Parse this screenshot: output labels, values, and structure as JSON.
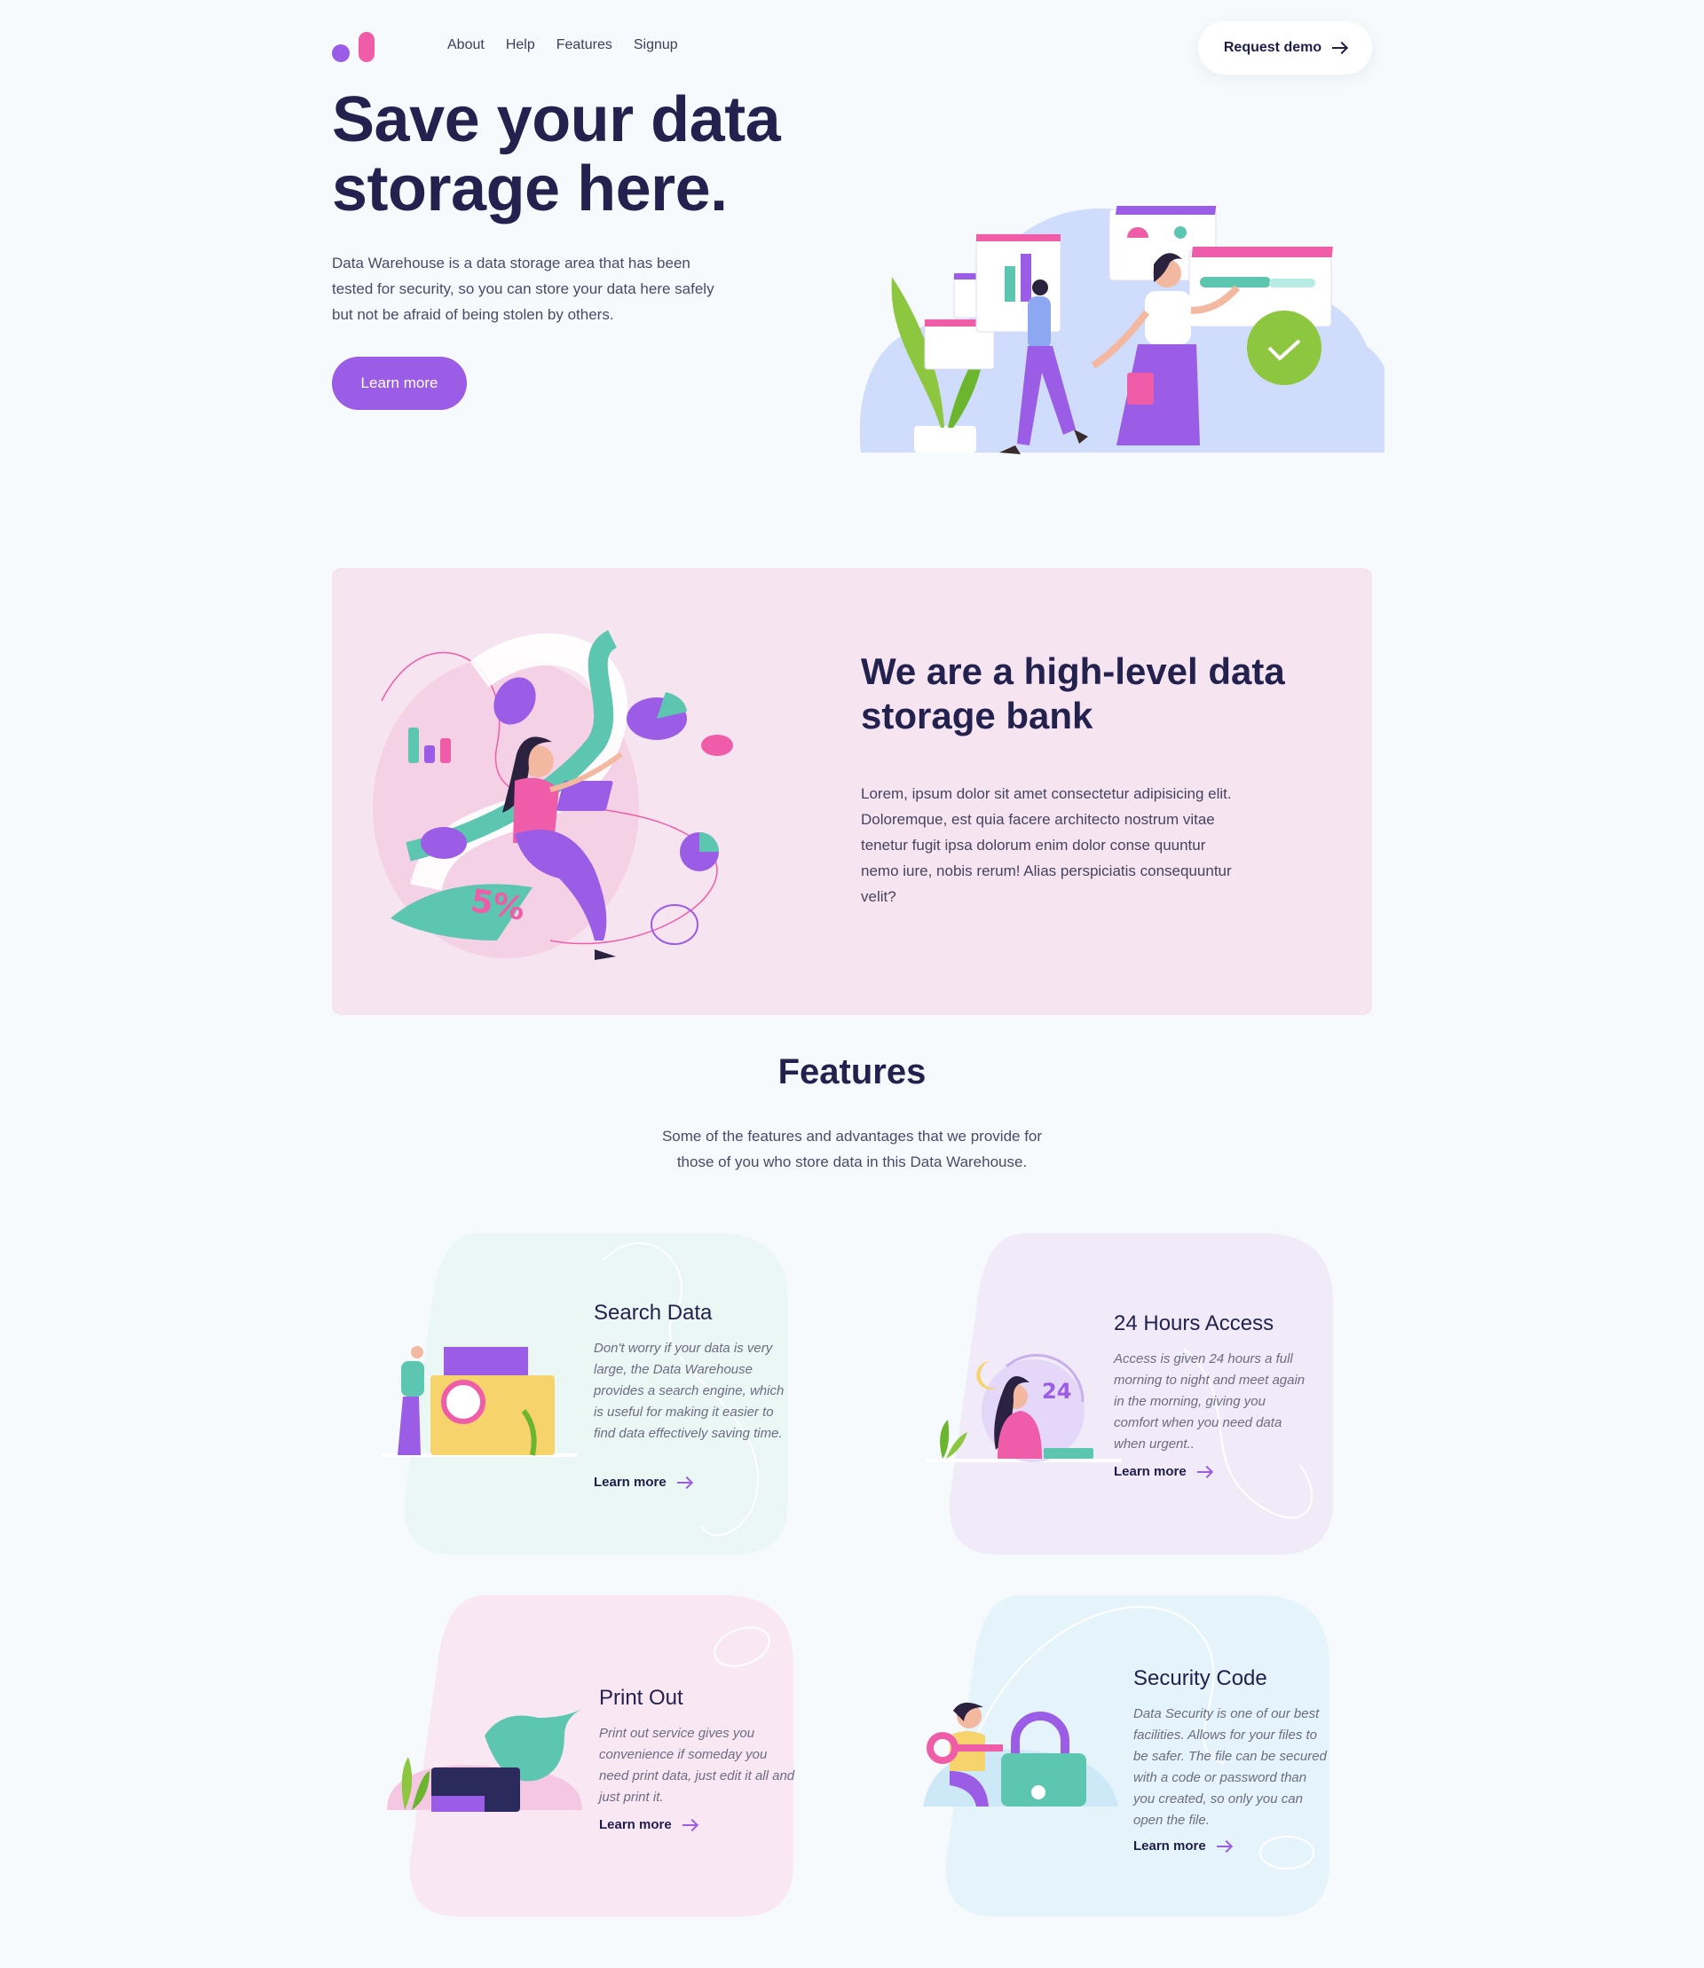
{
  "nav": {
    "links": [
      "About",
      "Help",
      "Features",
      "Signup"
    ],
    "demo_label": "Request demo"
  },
  "hero": {
    "title": "Save your data storage here.",
    "description": "Data Warehouse is a data storage area that has been tested for security, so you can store your data here safely but not be afraid of being stolen by others.",
    "cta": "Learn more"
  },
  "about": {
    "title": "We are a high-level data storage bank",
    "text": "Lorem, ipsum dolor sit amet consectetur adipisicing elit. Doloremque, est quia facere architecto nostrum vitae tenetur fugit ipsa dolorum enim dolor conse quuntur nemo iure, nobis rerum! Alias perspiciatis consequuntur velit?",
    "chart_badge": "5%"
  },
  "features": {
    "title": "Features",
    "subtitle": "Some of the features and advantages that we provide for those of you who store data in this Data Warehouse.",
    "cards": [
      {
        "title": "Search Data",
        "text": "Don't worry if your data is very large, the Data Warehouse provides a search engine, which is useful for making it easier to find data effectively saving time.",
        "link": "Learn more"
      },
      {
        "title": "24 Hours Access",
        "text": "Access is given 24 hours a full morning to night and meet again in the morning, giving you comfort when you need data when urgent..",
        "link": "Learn more",
        "badge": "24"
      },
      {
        "title": "Print Out",
        "text": "Print out service gives you convenience if someday you need print data, just edit it all and just print it.",
        "link": "Learn more"
      },
      {
        "title": "Security Code",
        "text": "Data Security is one of our best facilities. Allows for your files to be safer. The file can be secured with a code or password than you created, so only you can open the file.",
        "link": "Learn more"
      }
    ]
  },
  "colors": {
    "accent": "#9b5de5",
    "pink": "#ef5da8",
    "navy": "#23224f",
    "teal": "#5cc6b0",
    "banner_bg": "#f7e4f1"
  }
}
